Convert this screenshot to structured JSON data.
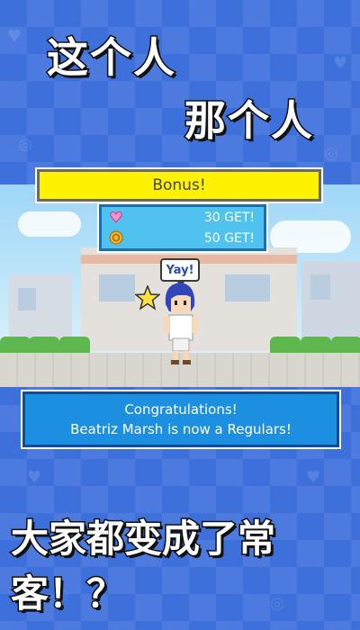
{
  "promo": {
    "line1": "这个人",
    "line2": "那个人",
    "line3": "大家都变成了常客！？"
  },
  "banner": {
    "title": "Bonus!"
  },
  "rewards": [
    {
      "icon": "heart-gem-icon",
      "text": "30 GET!"
    },
    {
      "icon": "coin-icon",
      "text": "50 GET!"
    }
  ],
  "speech": {
    "text": "Yay!"
  },
  "message": {
    "line1": "Congratulations!",
    "line2": "Beatriz Marsh is now a Regulars!"
  },
  "colors": {
    "background": "#3e70db",
    "banner_yellow": "#fff200",
    "reward_box": "#4fc2f0",
    "message_box": "#1d8fe0"
  }
}
